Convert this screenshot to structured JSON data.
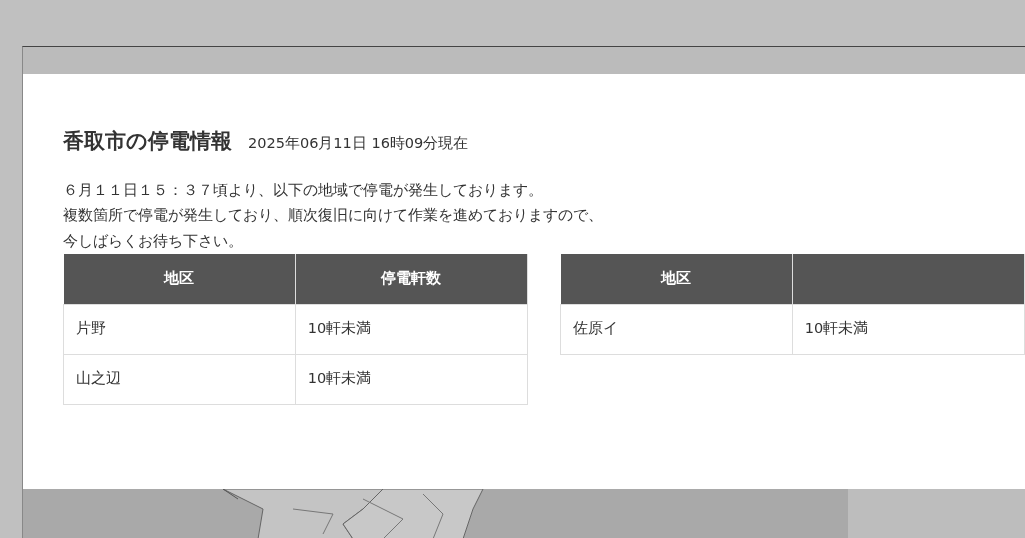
{
  "title": "香取市の停電情報",
  "timestamp": "2025年06月11日 16時09分現在",
  "message": [
    "６月１１日１５：３７頃より、以下の地域で停電が発生しております。",
    "複数箇所で停電が発生しており、順次復旧に向けて作業を進めておりますので、",
    "今しばらくお待ち下さい。"
  ],
  "tables": [
    {
      "columns": [
        "地区",
        "停電軒数"
      ],
      "rows": [
        [
          "片野",
          "10軒未満"
        ],
        [
          "山之辺",
          "10軒未満"
        ]
      ]
    },
    {
      "columns": [
        "地区"
      ],
      "rows": [
        [
          "佐原イ",
          "10軒未満"
        ]
      ]
    }
  ]
}
